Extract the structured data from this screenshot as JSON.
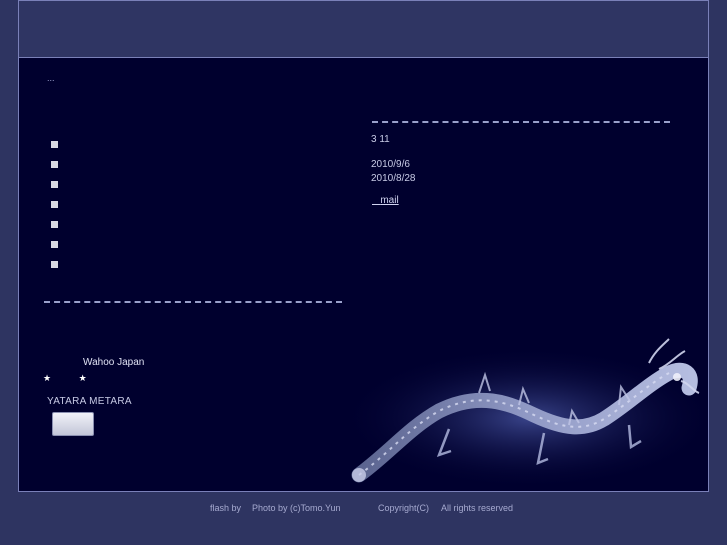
{
  "content": {
    "dots": "...",
    "bullets_count": 7,
    "news": {
      "line1": "3 11",
      "date1": "2010/9/6",
      "date2": "2010/8/28",
      "mail_label": "mail"
    },
    "links": {
      "wahoo": "Wahoo Japan",
      "star1": "★",
      "star2": "★",
      "yatara": "YATARA METARA"
    }
  },
  "footer": {
    "flash": "flash by",
    "photo": "Photo by (c)Tomo.Yun",
    "copyright": "Copyright(C)",
    "rights": "All rights reserved"
  },
  "colors": {
    "page_bg": "#2e3461",
    "frame_bg": "#00002e",
    "border": "#7a80b8"
  }
}
